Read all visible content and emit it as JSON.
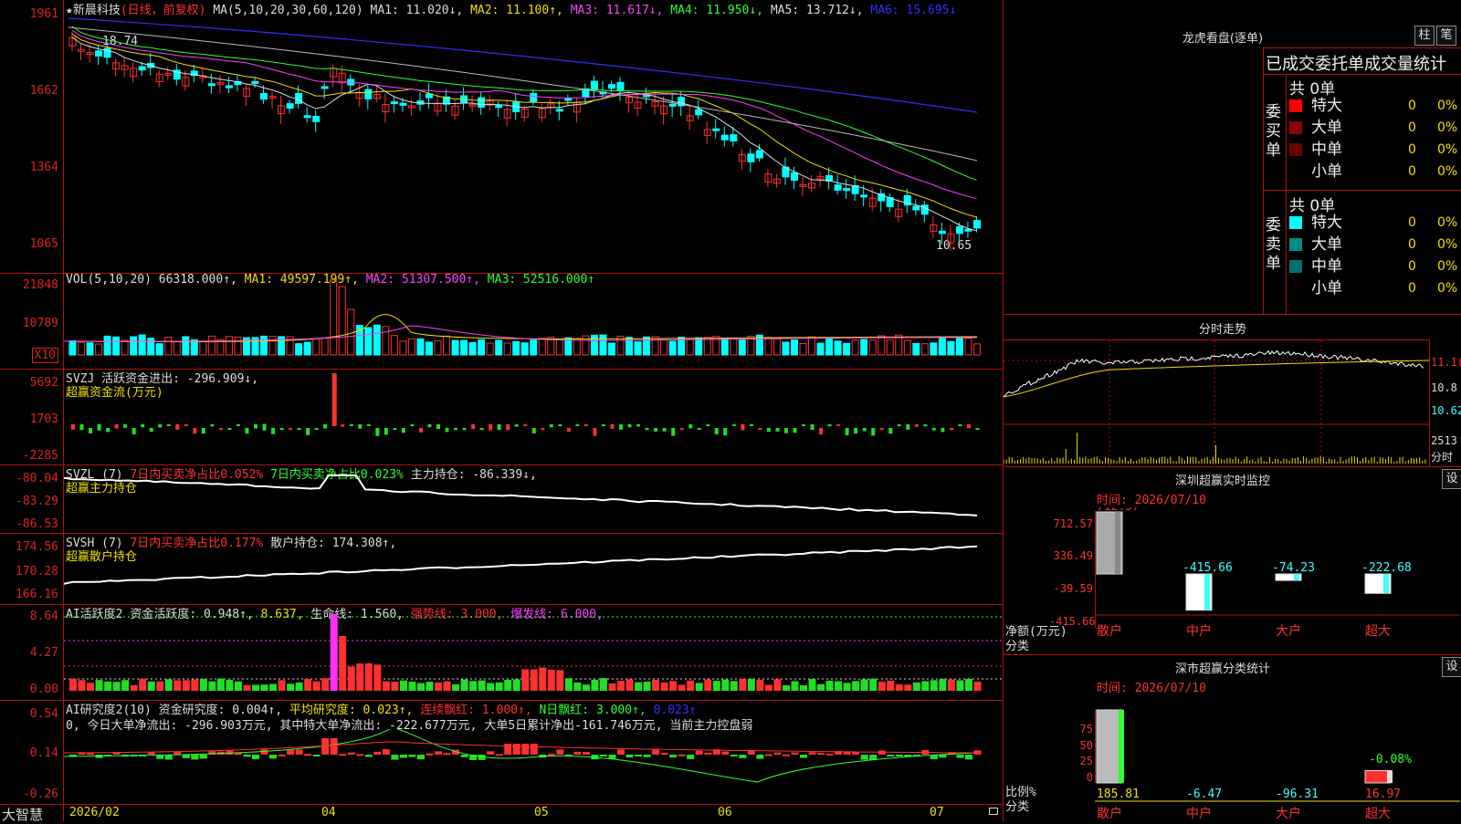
{
  "header": {
    "star": "★",
    "stock": "新晨科技",
    "mode": "(日线，前复权)",
    "ma_label": "MA(5,10,20,30,60,120)",
    "ma1": "MA1: 11.020↓,",
    "ma2": "MA2: 11.100↑,",
    "ma3": "MA3: 11.617↓,",
    "ma4": "MA4: 11.950↓,",
    "ma5": "MA5: 13.712↓,",
    "ma6": "MA6: 15.695↓"
  },
  "price_axis": [
    "1961",
    "1662",
    "1364",
    "1065"
  ],
  "price_notes": {
    "high": "18.74",
    "low": "10.65"
  },
  "vol": {
    "label": "VOL(5,10,20)",
    "val": "66318.000↑,",
    "ma1": "MA1: 49597.199↑,",
    "ma2": "MA2: 51307.500↑,",
    "ma3": "MA3: 52516.000↑",
    "axis": [
      "21848",
      "10789",
      "X10"
    ]
  },
  "svzj": {
    "label": "SVZJ  活跃资金进出: -296.909↓,",
    "sub": "超赢资金流(万元)",
    "axis": [
      "5692",
      "1703",
      "-2285"
    ]
  },
  "svzl": {
    "label": "SVZL (7)",
    "r1": "7日内买卖净占比0.052%",
    "r2": "7日内买卖净占比0.023%",
    "r3": "主力持仓: -86.339↓,",
    "sub": "超赢主力持仓",
    "axis": [
      "-80.04",
      "-83.29",
      "-86.53"
    ]
  },
  "svsh": {
    "label": "SVSH (7)",
    "r1": "7日内买卖净占比0.177%",
    "r2": "散户持仓: 174.308↑,",
    "sub": "超赢散户持仓",
    "axis": [
      "174.56",
      "170.28",
      "166.16"
    ]
  },
  "ai1": {
    "label": "AI活跃度2",
    "t1": "资金活跃度: 0.948↑,",
    "t2": "8.637,",
    "t3": "生命线: 1.560,",
    "t4": "强势线: 3.000,",
    "t5": "爆发线: 6.000,",
    "axis": [
      "8.64",
      "4.27",
      "0.00"
    ]
  },
  "ai2": {
    "label": "AI研究度2(10)",
    "t1": "资金研究度: 0.004↑,",
    "t2": "平均研究度: 0.023↑,",
    "t3": "连续飘红: 1.000↑,",
    "t4": "N日飘红: 3.000↑,",
    "t5": "0.023↑",
    "line2": "0, 今日大单净流出: -296.903万元, 其中特大单净流出: -222.677万元, 大单5日累计净出-161.746万元, 当前主力控盘弱",
    "axis": [
      "0.54",
      "0.14",
      "-0.26"
    ]
  },
  "dates": {
    "brand": "大智慧",
    "d1": "2026/02",
    "d2": "04",
    "d3": "05",
    "d4": "06",
    "d5": "07"
  },
  "right": {
    "lhb_title": "龙虎看盘(逐单)",
    "btn_zhu": "柱",
    "btn_bi": "笔",
    "stats_title": "已成交委托单成交量统计",
    "buy_label": "委买单",
    "sell_label": "委卖单",
    "buy_total": "共 0单",
    "sell_total": "共 0单",
    "buy_rows": [
      {
        "name": "特大",
        "count": "0",
        "pct": "0%",
        "color": "#ff0000"
      },
      {
        "name": "大单",
        "count": "0",
        "pct": "0%",
        "color": "#8b0000"
      },
      {
        "name": "中单",
        "count": "0",
        "pct": "0%",
        "color": "#6a0000"
      },
      {
        "name": "小单",
        "count": "0",
        "pct": "0%",
        "color": ""
      }
    ],
    "sell_rows": [
      {
        "name": "特大",
        "count": "0",
        "pct": "0%",
        "color": "#00ffff"
      },
      {
        "name": "大单",
        "count": "0",
        "pct": "0%",
        "color": "#008b8b"
      },
      {
        "name": "中单",
        "count": "0",
        "pct": "0%",
        "color": "#007070"
      },
      {
        "name": "小单",
        "count": "0",
        "pct": "0%",
        "color": ""
      }
    ],
    "intraday_title": "分时走势",
    "intraday_axis": [
      "11.1(",
      "10.8",
      "10.62",
      "2513",
      "分时"
    ],
    "monitor_title": "深圳超赢实时监控",
    "monitor_btn": "设",
    "monitor_time": "时间: 2026/07/10",
    "monitor_axis": [
      "712.57",
      "336.49",
      "-39.59",
      "-415.66"
    ],
    "monitor_ylabel": "净额(万元)",
    "monitor_xlabel": "分类",
    "monitor_values": [
      "712.57",
      "-415.66",
      "-74.23",
      "-222.68"
    ],
    "monitor_cats": [
      "散户",
      "中户",
      "大户",
      "超大"
    ],
    "class_title": "深市超赢分类统计",
    "class_btn": "设",
    "class_time": "时间: 2026/07/10",
    "class_axis": [
      "75",
      "50",
      "25",
      "0"
    ],
    "class_ylabel": "比例%",
    "class_xlabel": "分类",
    "class_bar_note": "-0.08%",
    "class_values": [
      "185.81",
      "-6.47",
      "-96.31",
      "16.97"
    ],
    "class_cats": [
      "散户",
      "中户",
      "大户",
      "超大"
    ]
  },
  "colors": {
    "up": "#ff3030",
    "down": "#00ffff",
    "grid": "#b01010"
  }
}
